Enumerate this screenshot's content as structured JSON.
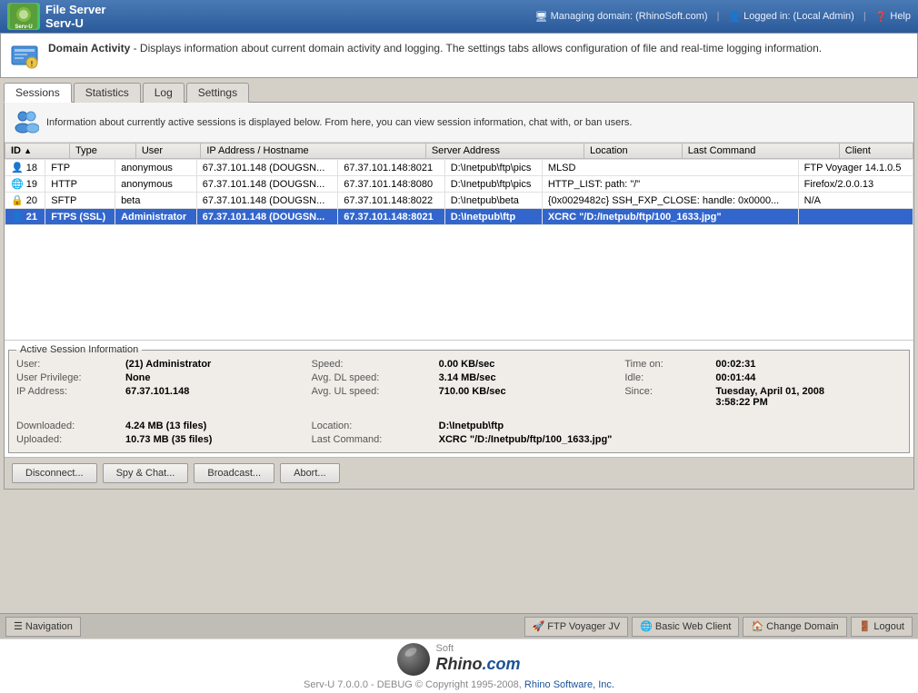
{
  "topbar": {
    "managing_domain_label": "Managing domain:",
    "managing_domain_value": "(RhinoSoft.com)",
    "logged_in_label": "Logged in:",
    "logged_in_value": "(Local Admin)",
    "help_label": "Help"
  },
  "logo": {
    "text": "File Server\nServ-U"
  },
  "domain_activity": {
    "title": "Domain Activity",
    "description": "- Displays information about current domain activity and logging. The settings tabs allows configuration of file and real-time logging information."
  },
  "tabs": [
    {
      "id": "sessions",
      "label": "Sessions",
      "active": true
    },
    {
      "id": "statistics",
      "label": "Statistics",
      "active": false
    },
    {
      "id": "log",
      "label": "Log",
      "active": false
    },
    {
      "id": "settings",
      "label": "Settings",
      "active": false
    }
  ],
  "info_banner": {
    "text": "Information about currently active sessions is displayed below. From here, you can view session information, chat with, or ban users."
  },
  "table": {
    "columns": [
      "ID",
      "Type",
      "User",
      "IP Address / Hostname",
      "Server Address",
      "Location",
      "Last Command",
      "Client"
    ],
    "rows": [
      {
        "id": "18",
        "type": "FTP",
        "user": "anonymous",
        "ip": "67.37.101.148 (DOUGSN...",
        "server": "67.37.101.148:8021",
        "location": "D:\\Inetpub\\ftp\\pics",
        "last_command": "MLSD",
        "client": "FTP Voyager 14.1.0.5",
        "selected": false
      },
      {
        "id": "19",
        "type": "HTTP",
        "user": "anonymous",
        "ip": "67.37.101.148 (DOUGSN...",
        "server": "67.37.101.148:8080",
        "location": "D:\\Inetpub\\ftp\\pics",
        "last_command": "HTTP_LIST: path: \"/\"",
        "client": "Firefox/2.0.0.13",
        "selected": false
      },
      {
        "id": "20",
        "type": "SFTP",
        "user": "beta",
        "ip": "67.37.101.148 (DOUGSN...",
        "server": "67.37.101.148:8022",
        "location": "D:\\Inetpub\\beta",
        "last_command": "{0x0029482c} SSH_FXP_CLOSE: handle: 0x0000...",
        "client": "N/A",
        "selected": false
      },
      {
        "id": "21",
        "type": "FTPS (SSL)",
        "user": "Administrator",
        "ip": "67.37.101.148 (DOUGSN...",
        "server": "67.37.101.148:8021",
        "location": "D:\\Inetpub\\ftp",
        "last_command": "XCRC \"/D:/Inetpub/ftp/100_1633.jpg\"",
        "client": "",
        "selected": true
      }
    ]
  },
  "active_session": {
    "legend": "Active Session Information",
    "fields": {
      "user_label": "User:",
      "user_value": "(21) Administrator",
      "user_priv_label": "User Privilege:",
      "user_priv_value": "None",
      "ip_label": "IP Address:",
      "ip_value": "67.37.101.148",
      "speed_label": "Speed:",
      "speed_value": "0.00 KB/sec",
      "avg_dl_label": "Avg. DL speed:",
      "avg_dl_value": "3.14 MB/sec",
      "avg_ul_label": "Avg. UL speed:",
      "avg_ul_value": "710.00 KB/sec",
      "time_on_label": "Time on:",
      "time_on_value": "00:02:31",
      "idle_label": "Idle:",
      "idle_value": "00:01:44",
      "since_label": "Since:",
      "since_value": "Tuesday, April 01, 2008",
      "since_time": "3:58:22 PM",
      "downloaded_label": "Downloaded:",
      "downloaded_value": "4.24 MB (13 files)",
      "uploaded_label": "Uploaded:",
      "uploaded_value": "10.73 MB (35 files)",
      "location_label": "Location:",
      "location_value": "D:\\Inetpub\\ftp",
      "last_cmd_label": "Last Command:",
      "last_cmd_value": "XCRC \"/D:/Inetpub/ftp/100_1633.jpg\""
    }
  },
  "buttons": {
    "disconnect": "Disconnect...",
    "spy_chat": "Spy & Chat...",
    "broadcast": "Broadcast...",
    "abort": "Abort..."
  },
  "bottom_bar": {
    "navigation": "Navigation",
    "ftp_voyager": "FTP Voyager JV",
    "basic_web": "Basic Web Client",
    "change_domain": "Change Domain",
    "logout": "Logout"
  },
  "footer": {
    "brand_soft": "Soft",
    "brand_rhino": "Rhino",
    "brand_com": ".com",
    "copyright": "Serv-U 7.0.0.0 - DEBUG © Copyright 1995-2008,",
    "company": "Rhino Software, Inc."
  }
}
